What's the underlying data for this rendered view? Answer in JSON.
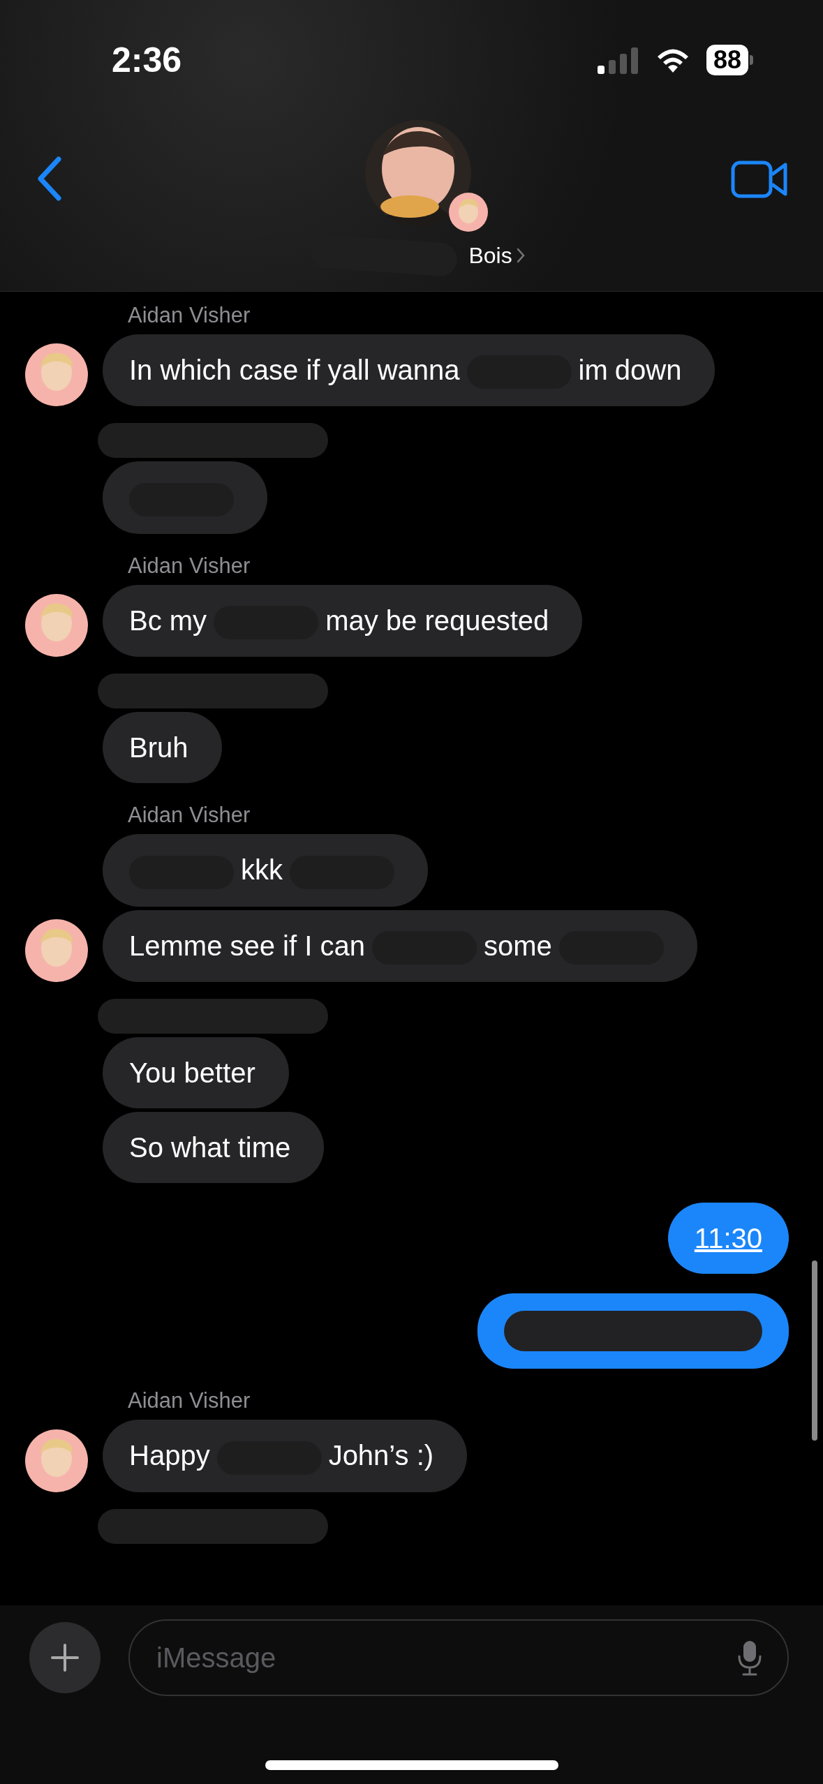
{
  "status_bar": {
    "time": "2:36",
    "battery": "88"
  },
  "header": {
    "title": "Bois"
  },
  "messages": [
    {
      "kind": "name",
      "text": "Aidan Visher"
    },
    {
      "kind": "in",
      "avatar": true,
      "parts": [
        {
          "kind": "text",
          "text": "In which case if yall wanna"
        },
        {
          "kind": "redacted"
        },
        {
          "kind": "text",
          "text": "im"
        },
        {
          "kind": "text",
          "text": "down"
        }
      ]
    },
    {
      "kind": "redacted_name"
    },
    {
      "kind": "in",
      "avatar": false,
      "parts": [
        {
          "kind": "redacted"
        }
      ]
    },
    {
      "kind": "name",
      "text": "Aidan Visher"
    },
    {
      "kind": "in",
      "avatar": true,
      "parts": [
        {
          "kind": "text",
          "text": "Bc my"
        },
        {
          "kind": "redacted"
        },
        {
          "kind": "text",
          "text": "may be requested"
        }
      ]
    },
    {
      "kind": "redacted_name"
    },
    {
      "kind": "in",
      "avatar": false,
      "parts": [
        {
          "kind": "text",
          "text": "Bruh"
        }
      ]
    },
    {
      "kind": "name",
      "text": "Aidan Visher"
    },
    {
      "kind": "in",
      "avatar": false,
      "parts": [
        {
          "kind": "redacted"
        },
        {
          "kind": "text",
          "text": "kkk"
        },
        {
          "kind": "redacted"
        }
      ]
    },
    {
      "kind": "in",
      "avatar": true,
      "parts": [
        {
          "kind": "text",
          "text": "Lemme see if I can"
        },
        {
          "kind": "redacted"
        },
        {
          "kind": "text",
          "text": "some"
        },
        {
          "kind": "redacted"
        }
      ]
    },
    {
      "kind": "redacted_name"
    },
    {
      "kind": "in",
      "avatar": false,
      "parts": [
        {
          "kind": "text",
          "text": "You better"
        }
      ]
    },
    {
      "kind": "in",
      "avatar": false,
      "parts": [
        {
          "kind": "text",
          "text": "So what time"
        }
      ]
    },
    {
      "kind": "out",
      "parts": [
        {
          "kind": "link",
          "text": "11:30"
        }
      ]
    },
    {
      "kind": "out",
      "parts": [
        {
          "kind": "redacted_wide"
        }
      ]
    },
    {
      "kind": "name",
      "text": "Aidan Visher"
    },
    {
      "kind": "in",
      "avatar": true,
      "parts": [
        {
          "kind": "text",
          "text": "Happy"
        },
        {
          "kind": "redacted"
        },
        {
          "kind": "text",
          "text": "John’s :)"
        }
      ]
    },
    {
      "kind": "redacted_name"
    }
  ],
  "composer": {
    "placeholder": "iMessage"
  }
}
